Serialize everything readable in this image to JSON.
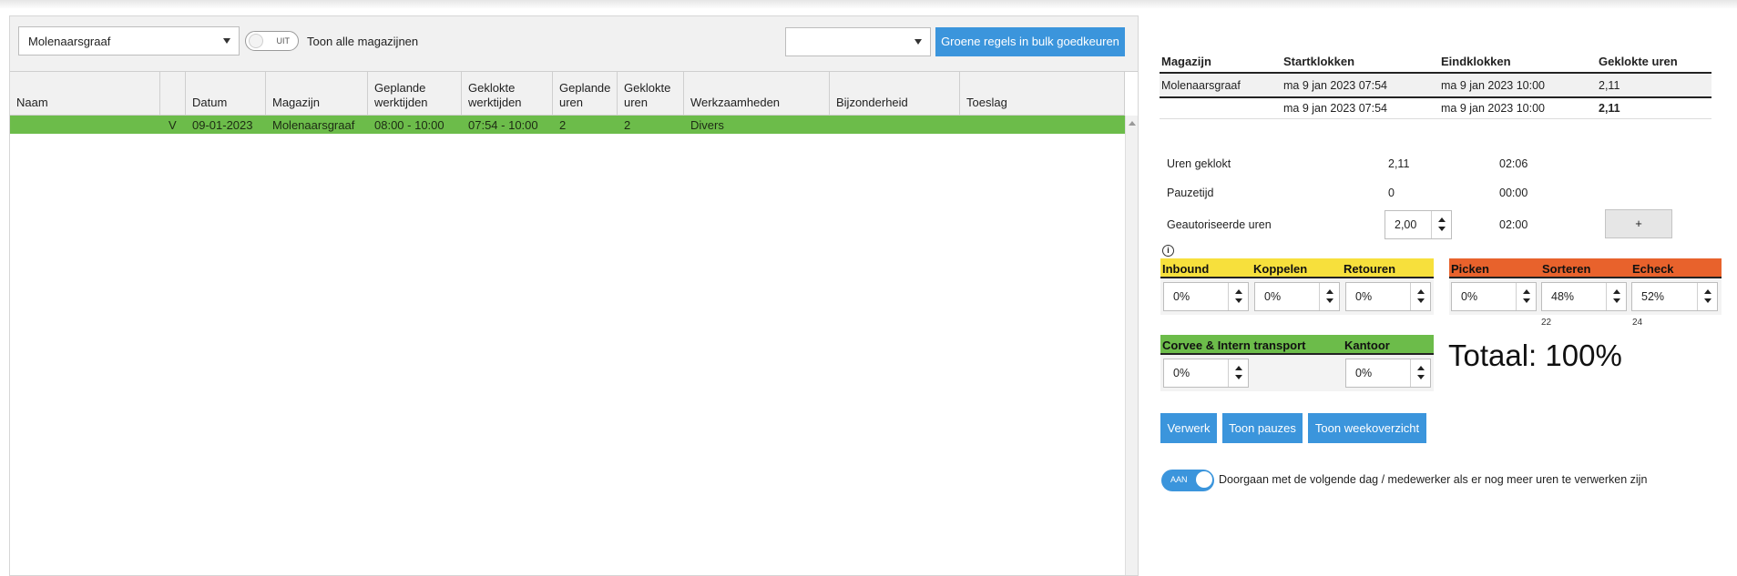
{
  "toolbar": {
    "warehouse_select_value": "Molenaarsgraaf",
    "show_all_toggle_state": "UIT",
    "show_all_label": "Toon alle magazijnen",
    "filter_select_value": "",
    "bulk_approve_label": "Groene regels in bulk goedkeuren"
  },
  "grid": {
    "columns": [
      "Naam",
      "",
      "Datum",
      "Magazijn",
      "Geplande werktijden",
      "Geklokte werktijden",
      "Geplande uren",
      "Geklokte uren",
      "Werkzaamheden",
      "Bijzonderheid",
      "Toeslag"
    ],
    "column_lines": [
      [
        "Naam"
      ],
      [
        ""
      ],
      [
        "Datum"
      ],
      [
        "Magazijn"
      ],
      [
        "Geplande",
        "werktijden"
      ],
      [
        "Geklokte",
        "werktijden"
      ],
      [
        "Geplande",
        "uren"
      ],
      [
        "Geklokte",
        "uren"
      ],
      [
        "Werkzaamheden"
      ],
      [
        "Bijzonderheid"
      ],
      [
        "Toeslag"
      ]
    ],
    "rows": [
      [
        "",
        "V",
        "09-01-2023",
        "Molenaarsgraaf",
        "08:00 - 10:00",
        "07:54 - 10:00",
        "2",
        "2",
        "Divers",
        "",
        ""
      ]
    ],
    "row_color": "#6cbc4a"
  },
  "clock_table": {
    "headers": [
      "Magazijn",
      "Startklokken",
      "Eindklokken",
      "Geklokte uren"
    ],
    "rows": [
      [
        "Molenaarsgraaf",
        "ma 9 jan 2023 07:54",
        "ma 9 jan 2023 10:00",
        "2,11"
      ],
      [
        "",
        "ma 9 jan 2023 07:54",
        "ma 9 jan 2023 10:00",
        "2,11"
      ]
    ]
  },
  "stats": {
    "uren_geklokt": {
      "label": "Uren geklokt",
      "value": "2,11",
      "time": "02:06"
    },
    "pauzetijd": {
      "label": "Pauzetijd",
      "value": "0",
      "time": "00:00"
    },
    "geautoriseerde": {
      "label": "Geautoriseerde uren",
      "value": "2,00",
      "time": "02:00"
    },
    "plus_label": "+",
    "info_label": "i"
  },
  "categories": {
    "yellow_color": "#f7e03c",
    "orange_color": "#e8622c",
    "green_color": "#6cbc4a",
    "inbound": {
      "label": "Inbound",
      "value": "0%"
    },
    "koppelen": {
      "label": "Koppelen",
      "value": "0%"
    },
    "retouren": {
      "label": "Retouren",
      "value": "0%"
    },
    "picken": {
      "label": "Picken",
      "value": "0%"
    },
    "sorteren": {
      "label": "Sorteren",
      "value": "48%",
      "note": "22"
    },
    "echeck": {
      "label": "Echeck",
      "value": "52%",
      "note": "24"
    },
    "corvee": {
      "label": "Corvee & Intern transport",
      "value": "0%"
    },
    "kantoor": {
      "label": "Kantoor",
      "value": "0%"
    }
  },
  "totaal_label": "Totaal: 100%",
  "actions": {
    "verwerk": "Verwerk",
    "toon_pauzes": "Toon pauzes",
    "toon_weekoverzicht": "Toon weekoverzicht"
  },
  "follow_toggle": {
    "state": "AAN",
    "label": "Doorgaan met de volgende dag / medewerker als er nog meer uren te verwerken zijn"
  },
  "accent_color": "#3b95dc"
}
